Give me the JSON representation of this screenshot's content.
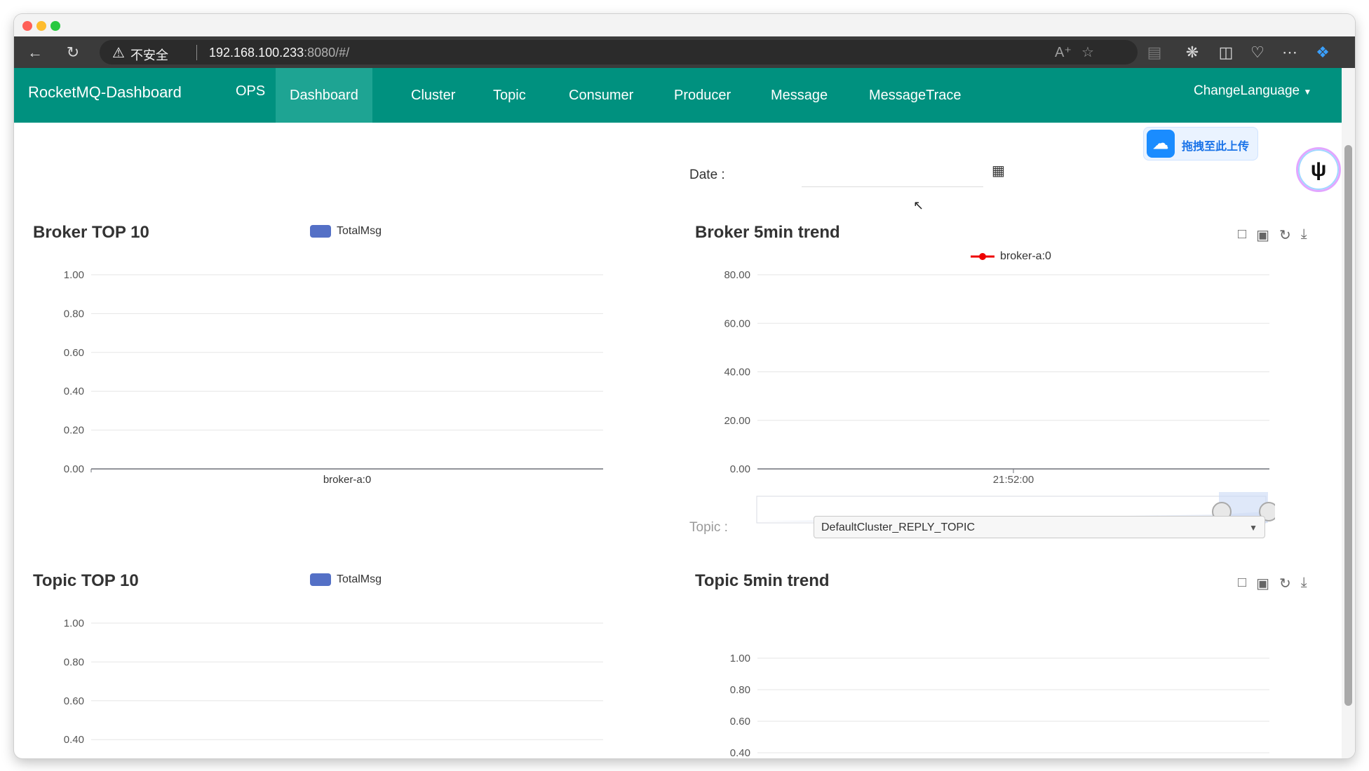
{
  "browser": {
    "security_label": "不安全",
    "url_host": "192.168.100.233",
    "url_rest": ":8080/#/"
  },
  "navbar": {
    "brand": "RocketMQ-Dashboard",
    "items": [
      "OPS",
      "Dashboard",
      "Cluster",
      "Topic",
      "Consumer",
      "Producer",
      "Message",
      "MessageTrace"
    ],
    "active": "Dashboard",
    "language": "ChangeLanguage"
  },
  "filters": {
    "date_label": "Date :",
    "date_value": "",
    "topic_label": "Topic :",
    "topic_value": "DefaultCluster_REPLY_TOPIC"
  },
  "upload_widget": {
    "label": "拖拽至此上传"
  },
  "colors": {
    "navbar": "#00917f",
    "navbar_active": "#1ea493",
    "bar_series": "#5470c6",
    "trend_series": "#ee0000"
  },
  "chart_data": [
    {
      "id": "broker-top10",
      "type": "bar",
      "title": "Broker TOP 10",
      "legend": [
        "TotalMsg"
      ],
      "categories": [
        "broker-a:0"
      ],
      "series": [
        {
          "name": "TotalMsg",
          "values": [
            0
          ]
        }
      ],
      "ylim": [
        0,
        1
      ],
      "yticks": [
        "1.00",
        "0.80",
        "0.60",
        "0.40",
        "0.20",
        "0.00"
      ],
      "grid": true
    },
    {
      "id": "broker-5min-trend",
      "type": "line",
      "title": "Broker 5min trend",
      "legend": [
        "broker-a:0"
      ],
      "x": [
        "21:52:00"
      ],
      "series": [
        {
          "name": "broker-a:0",
          "values": []
        }
      ],
      "ylim": [
        0,
        80
      ],
      "yticks": [
        "80.00",
        "60.00",
        "40.00",
        "20.00",
        "0.00"
      ],
      "grid": true,
      "data_zoom": true
    },
    {
      "id": "topic-top10",
      "type": "bar",
      "title": "Topic TOP 10",
      "legend": [
        "TotalMsg"
      ],
      "categories": [],
      "series": [
        {
          "name": "TotalMsg",
          "values": []
        }
      ],
      "ylim": [
        0,
        1
      ],
      "yticks": [
        "1.00",
        "0.80",
        "0.60",
        "0.40"
      ],
      "grid": true
    },
    {
      "id": "topic-5min-trend",
      "type": "line",
      "title": "Topic 5min trend",
      "legend": [],
      "x": [],
      "series": [],
      "ylim": [
        0,
        1
      ],
      "yticks": [
        "1.00",
        "0.80",
        "0.60",
        "0.40"
      ],
      "grid": true
    }
  ]
}
